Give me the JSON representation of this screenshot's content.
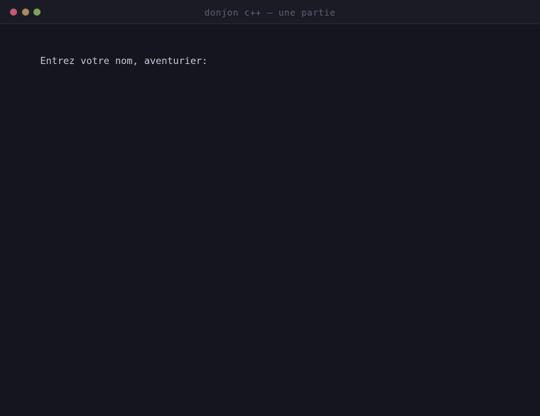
{
  "window": {
    "title": "donjon c++ — une partie",
    "buttons": {
      "close_color": "#c25b72",
      "minimize_color": "#a98a5c",
      "zoom_color": "#7fa35e"
    }
  },
  "terminal": {
    "prompt": "Entrez votre nom, aventurier:"
  },
  "colors": {
    "background": "#15151e",
    "titlebar": "#1b1b26",
    "text": "#c9c8d8",
    "title_text": "#5e5d70"
  }
}
